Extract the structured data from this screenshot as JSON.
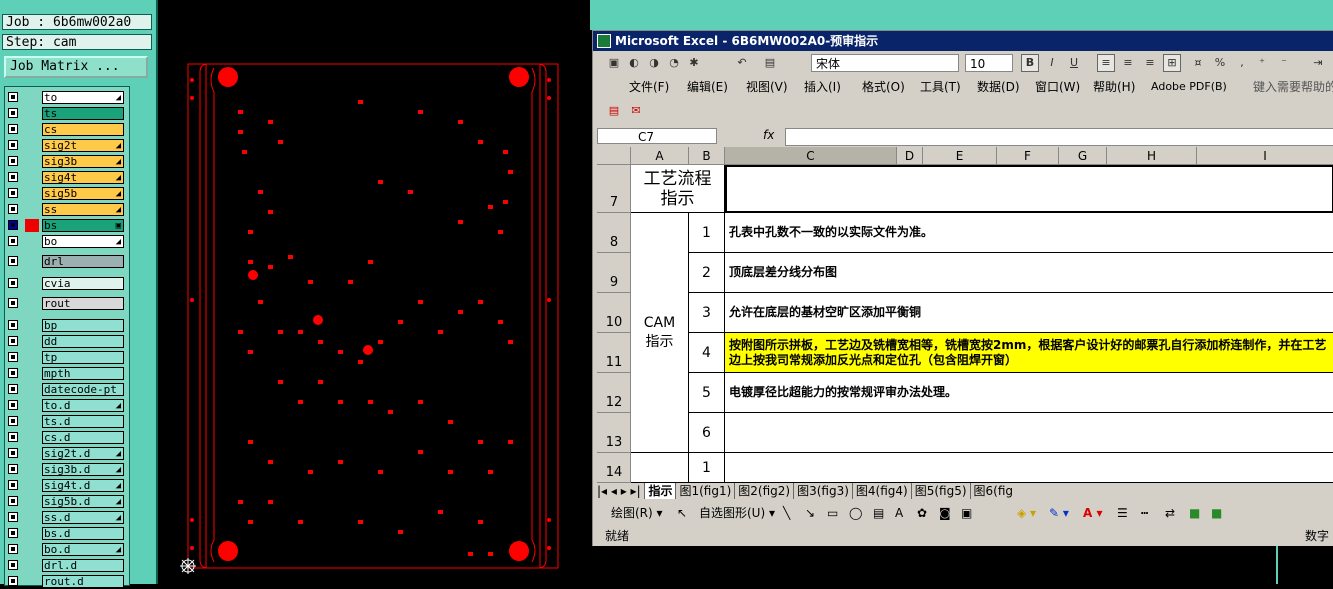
{
  "job_label": "Job : 6b6mw002a0",
  "step_label": "Step: cam",
  "job_matrix_button": "Job Matrix ...",
  "layers": [
    {
      "name": "to",
      "color": "#ffffff",
      "mark": "◢"
    },
    {
      "name": "ts",
      "color": "#1aa37a",
      "mark": ""
    },
    {
      "name": "cs",
      "color": "#ffc94a",
      "mark": ""
    },
    {
      "name": "sig2t",
      "color": "#ffc94a",
      "mark": "◢"
    },
    {
      "name": "sig3b",
      "color": "#ffc94a",
      "mark": "◢"
    },
    {
      "name": "sig4t",
      "color": "#ffc94a",
      "mark": "◢"
    },
    {
      "name": "sig5b",
      "color": "#ffc94a",
      "mark": "◢"
    },
    {
      "name": "ss",
      "color": "#ffc94a",
      "mark": "◢"
    },
    {
      "name": "bs",
      "color": "#1aa37a",
      "mark": "▣"
    },
    {
      "name": "bo",
      "color": "#ffffff",
      "mark": "◢"
    },
    {
      "name": "drl",
      "color": "#9bb0b0",
      "mark": ""
    },
    {
      "name": "cvia",
      "color": "#dff3ec",
      "mark": ""
    },
    {
      "name": "rout",
      "color": "#d8d8d8",
      "mark": ""
    },
    {
      "name": "bp",
      "color": "#8fe0d0",
      "mark": ""
    },
    {
      "name": "dd",
      "color": "#8fe0d0",
      "mark": ""
    },
    {
      "name": "tp",
      "color": "#8fe0d0",
      "mark": ""
    },
    {
      "name": "mpth",
      "color": "#8fe0d0",
      "mark": ""
    },
    {
      "name": "datecode-pt",
      "color": "#8fe0d0",
      "mark": ""
    },
    {
      "name": "to.d",
      "color": "#8fe0d0",
      "mark": "◢"
    },
    {
      "name": "ts.d",
      "color": "#8fe0d0",
      "mark": ""
    },
    {
      "name": "cs.d",
      "color": "#8fe0d0",
      "mark": ""
    },
    {
      "name": "sig2t.d",
      "color": "#8fe0d0",
      "mark": "◢"
    },
    {
      "name": "sig3b.d",
      "color": "#8fe0d0",
      "mark": "◢"
    },
    {
      "name": "sig4t.d",
      "color": "#8fe0d0",
      "mark": "◢"
    },
    {
      "name": "sig5b.d",
      "color": "#8fe0d0",
      "mark": "◢"
    },
    {
      "name": "ss.d",
      "color": "#8fe0d0",
      "mark": "◢"
    },
    {
      "name": "bs.d",
      "color": "#8fe0d0",
      "mark": ""
    },
    {
      "name": "bo.d",
      "color": "#8fe0d0",
      "mark": "◢"
    },
    {
      "name": "drl.d",
      "color": "#8fe0d0",
      "mark": ""
    },
    {
      "name": "rout.d",
      "color": "#8fe0d0",
      "mark": ""
    }
  ],
  "excel": {
    "title": "Microsoft Excel - 6B6MW002A0-预审指示",
    "font_name": "宋体",
    "font_size": "10",
    "menus": [
      "文件(F)",
      "编辑(E)",
      "视图(V)",
      "插入(I)",
      "格式(O)",
      "工具(T)",
      "数据(D)",
      "窗口(W)",
      "帮助(H)",
      "Adobe PDF(B)"
    ],
    "help_box": "键入需要帮助的",
    "name_box": "C7",
    "fx": "fx",
    "columns": [
      "A",
      "B",
      "C",
      "D",
      "E",
      "F",
      "G",
      "H",
      "I"
    ],
    "rows": [
      "7",
      "8",
      "9",
      "10",
      "11",
      "12",
      "13",
      "14"
    ],
    "header_cell": "工艺流程指示",
    "cam_cell": "CAM\n指示",
    "items": [
      {
        "num": "1",
        "text": "孔表中孔数不一致的以实际文件为准。",
        "highlight": false
      },
      {
        "num": "2",
        "text": "顶底层差分线分布图",
        "highlight": false
      },
      {
        "num": "3",
        "text": "允许在底层的基材空旷区添加平衡铜",
        "highlight": false
      },
      {
        "num": "4",
        "text": "按附图所示拼板，工艺边及铣槽宽相等，铣槽宽按2mm，根据客户设计好的邮票孔自行添加桥连制作，并在工艺边上按我司常规添加反光点和定位孔（包含阻焊开窗）",
        "highlight": true
      },
      {
        "num": "5",
        "text": "电镀厚径比超能力的按常规评审办法处理。",
        "highlight": false
      },
      {
        "num": "6",
        "text": "",
        "highlight": false
      },
      {
        "num": "1",
        "text": "",
        "highlight": false
      }
    ],
    "sheet_tabs": [
      "指示",
      "图1(fig1)",
      "图2(fig2)",
      "图3(fig3)",
      "图4(fig4)",
      "图5(fig5)",
      "图6(fig"
    ],
    "draw_label": "绘图(R) ▾",
    "autoshape_label": "自选图形(U) ▾",
    "status_left": "就绪",
    "status_right": "数字"
  },
  "colors": {
    "teal": "#5fd0b8",
    "board_red": "#ff0000",
    "excel_title": "#0a246a",
    "highlight": "#ffff00"
  }
}
